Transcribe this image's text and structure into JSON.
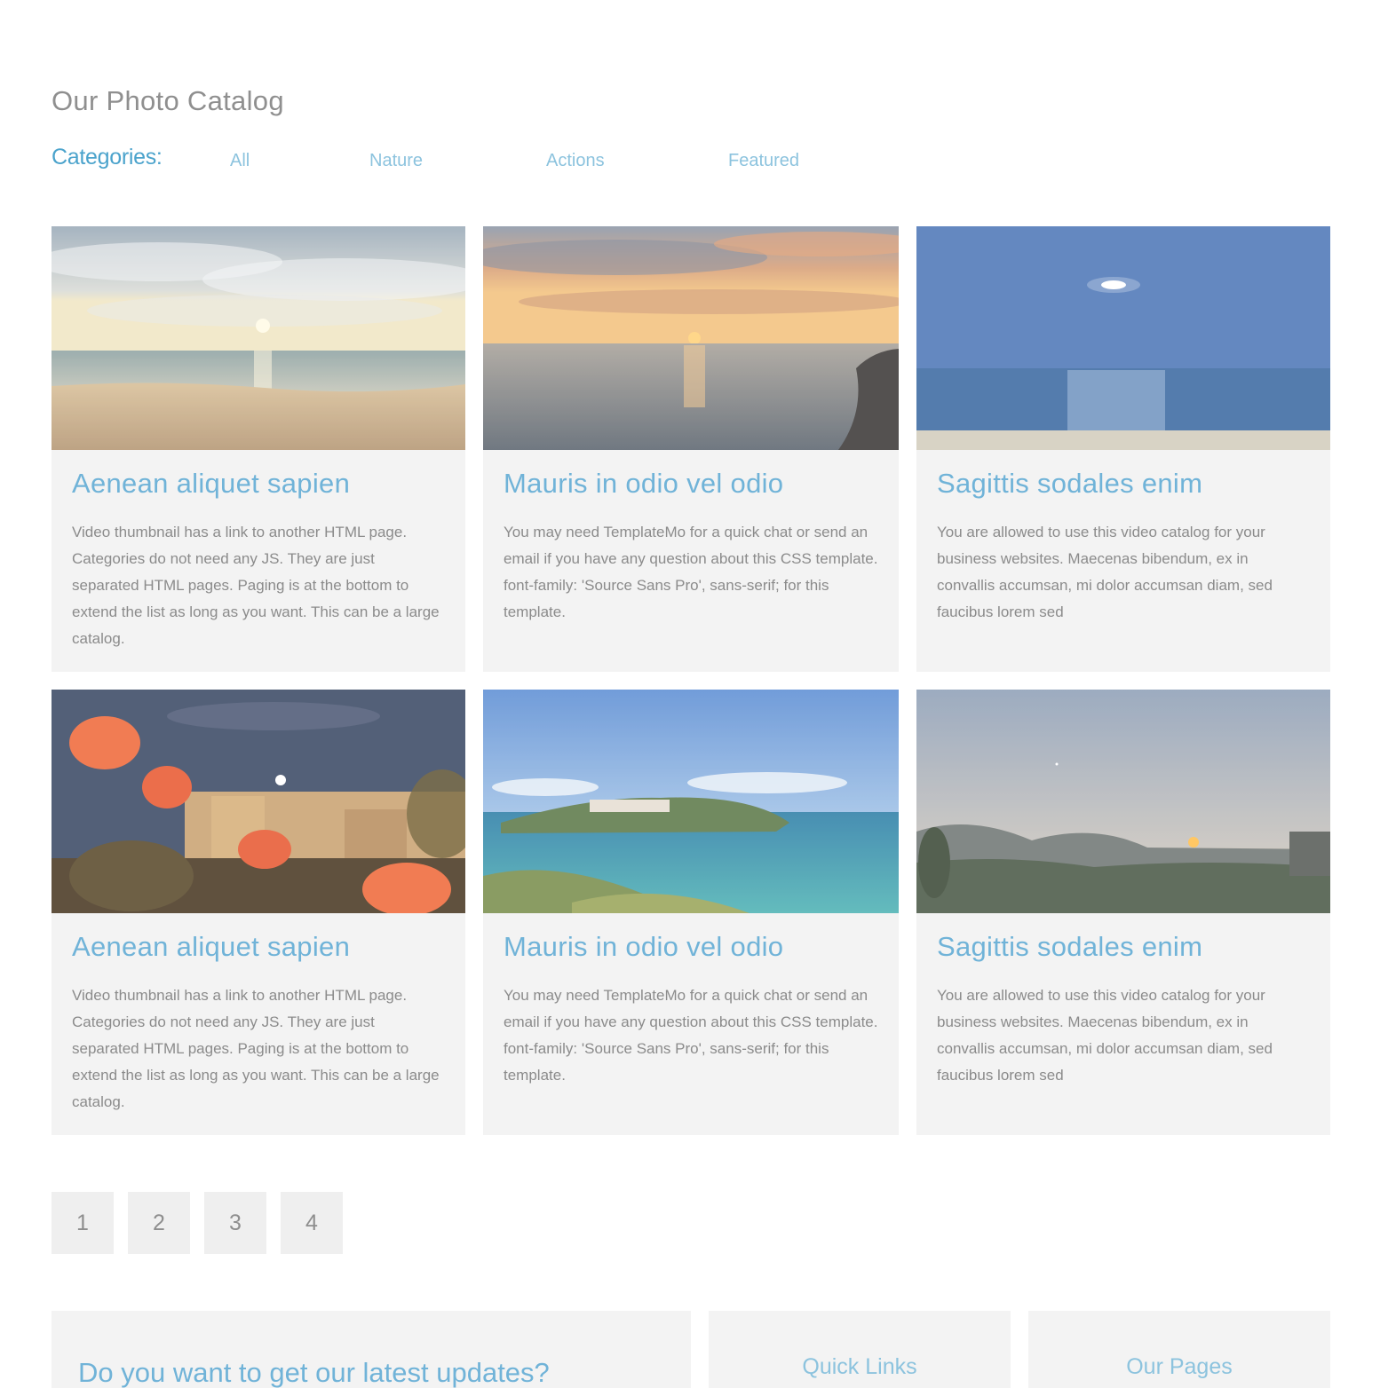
{
  "catalog": {
    "title": "Our Photo Catalog"
  },
  "categories": {
    "label": "Categories:",
    "items": [
      {
        "label": "All"
      },
      {
        "label": "Nature"
      },
      {
        "label": "Actions"
      },
      {
        "label": "Featured"
      }
    ]
  },
  "cards": [
    {
      "title": "Aenean aliquet sapien",
      "text": "Video thumbnail has a link to another HTML page. Categories do not need any JS. They are just separated HTML pages. Paging is at the bottom to extend the list as long as you want. This can be a large catalog.",
      "image": "beach-sunrise-clouds-photo"
    },
    {
      "title": "Mauris in odio vel odio",
      "text": "You may need TemplateMo for a quick chat or send an email if you have any question about this CSS template. font-family: 'Source Sans Pro', sans-serif; for this template.",
      "image": "sea-sunset-rocks-photo"
    },
    {
      "title": "Sagittis sodales enim",
      "text": "You are allowed to use this video catalog for your business websites. Maecenas bibendum, ex in convallis accumsan, mi dolor accumsan diam, sed faucibus lorem sed",
      "image": "moon-over-sea-photo"
    },
    {
      "title": "Aenean aliquet sapien",
      "text": "Video thumbnail has a link to another HTML page. Categories do not need any JS. They are just separated HTML pages. Paging is at the bottom to extend the list as long as you want. This can be a large catalog.",
      "image": "flowers-night-town-photo"
    },
    {
      "title": "Mauris in odio vel odio",
      "text": "You may need TemplateMo for a quick chat or send an email if you have any question about this CSS template. font-family: 'Source Sans Pro', sans-serif; for this template.",
      "image": "turquoise-cove-photo"
    },
    {
      "title": "Sagittis sodales enim",
      "text": "You are allowed to use this video catalog for your business websites. Maecenas bibendum, ex in convallis accumsan, mi dolor accumsan diam, sed faucibus lorem sed",
      "image": "mountain-sunset-photo"
    }
  ],
  "pagination": {
    "pages": [
      "1",
      "2",
      "3",
      "4"
    ]
  },
  "footer": {
    "newsletter_title": "Do you want to get our latest updates?",
    "quick_links_title": "Quick Links",
    "our_pages_title": "Our Pages"
  },
  "colors": {
    "accent": "#4ba3cc",
    "link": "#8cc3de",
    "card_bg": "#f3f3f3"
  }
}
